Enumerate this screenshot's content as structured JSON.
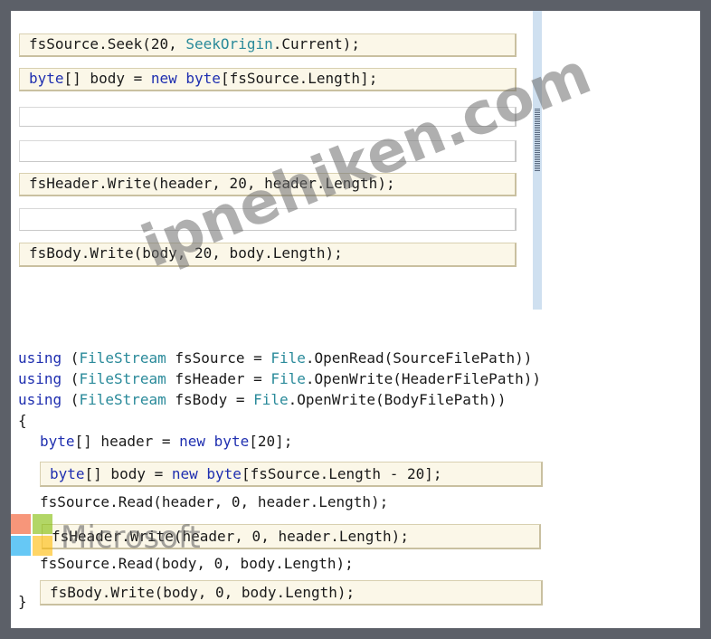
{
  "source_tiles": [
    {
      "label": "fsSource.Seek(20, SeekOrigin.Current);",
      "parts": [
        {
          "t": "fsSource.Seek(20, "
        },
        {
          "t": "SeekOrigin",
          "c": "ty"
        },
        {
          "t": ".Current);"
        }
      ]
    },
    {
      "label": "byte[] body = new byte[fsSource.Length];",
      "parts": [
        {
          "t": "byte",
          "c": "kw"
        },
        {
          "t": "[] body = "
        },
        {
          "t": "new",
          "c": "kw"
        },
        {
          "t": " "
        },
        {
          "t": "byte",
          "c": "kw"
        },
        {
          "t": "[fsSource.Length];"
        }
      ]
    },
    {
      "label": "",
      "parts": []
    },
    {
      "label": "",
      "parts": []
    },
    {
      "label": "fsHeader.Write(header, 20, header.Length);",
      "parts": [
        {
          "t": "fsHeader.Write(header, 20, header.Length);"
        }
      ]
    },
    {
      "label": "",
      "parts": []
    },
    {
      "label": "fsBody.Write(body, 20, body.Length);",
      "parts": [
        {
          "t": "fsBody.Write(body, 20, body.Length);"
        }
      ]
    }
  ],
  "code": {
    "using1": [
      {
        "t": "using",
        "c": "kw"
      },
      {
        "t": " ("
      },
      {
        "t": "FileStream",
        "c": "ty"
      },
      {
        "t": " fsSource = "
      },
      {
        "t": "File",
        "c": "ty"
      },
      {
        "t": ".OpenRead(SourceFilePath))"
      }
    ],
    "using2": [
      {
        "t": "using",
        "c": "kw"
      },
      {
        "t": " ("
      },
      {
        "t": "FileStream",
        "c": "ty"
      },
      {
        "t": " fsHeader = "
      },
      {
        "t": "File",
        "c": "ty"
      },
      {
        "t": ".OpenWrite(HeaderFilePath))"
      }
    ],
    "using3": [
      {
        "t": "using",
        "c": "kw"
      },
      {
        "t": " ("
      },
      {
        "t": "FileStream",
        "c": "ty"
      },
      {
        "t": " fsBody = "
      },
      {
        "t": "File",
        "c": "ty"
      },
      {
        "t": ".OpenWrite(BodyFilePath))"
      }
    ],
    "open_brace": "{",
    "header_decl": [
      {
        "t": "byte",
        "c": "kw"
      },
      {
        "t": "[] header = "
      },
      {
        "t": "new",
        "c": "kw"
      },
      {
        "t": " "
      },
      {
        "t": "byte",
        "c": "kw"
      },
      {
        "t": "[20];"
      }
    ],
    "read_header": [
      {
        "t": "fsSource.Read(header, 0, header.Length);"
      }
    ],
    "read_body": [
      {
        "t": "fsSource.Read(body, 0, body.Length);"
      }
    ],
    "close_brace": "}"
  },
  "placed_tiles": {
    "body_decl": [
      {
        "t": "byte",
        "c": "kw"
      },
      {
        "t": "[] body = "
      },
      {
        "t": "new",
        "c": "kw"
      },
      {
        "t": " "
      },
      {
        "t": "byte",
        "c": "kw"
      },
      {
        "t": "[fsSource.Length - 20];"
      }
    ],
    "write_header": [
      {
        "t": "fsHeader.Write(header, 0, header.Length);"
      }
    ],
    "write_body": [
      {
        "t": "fsBody.Write(body, 0, body.Length);"
      }
    ]
  },
  "watermark": "ipnehiken.com",
  "ms_logo_text": "Microsoft",
  "ms_logo_colors": [
    "#f25022",
    "#7fba00",
    "#00a4ef",
    "#ffb900"
  ]
}
